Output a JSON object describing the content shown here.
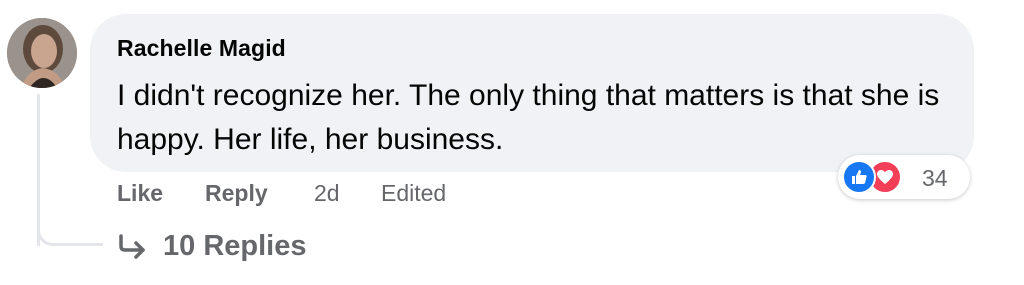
{
  "comment": {
    "author": "Rachelle Magid",
    "text": "I didn't recognize her. The only thing that matters is that she is happy. Her life, her business.",
    "avatar_icon": "profile-photo"
  },
  "actions": {
    "like_label": "Like",
    "reply_label": "Reply",
    "time": "2d",
    "edited_label": "Edited"
  },
  "reactions": {
    "icons": [
      "like-icon",
      "love-icon"
    ],
    "count": "34",
    "like_color": "#1877f2",
    "love_color": "#f33e58"
  },
  "replies": {
    "label": "10 Replies",
    "icon": "reply-arrow-icon"
  }
}
